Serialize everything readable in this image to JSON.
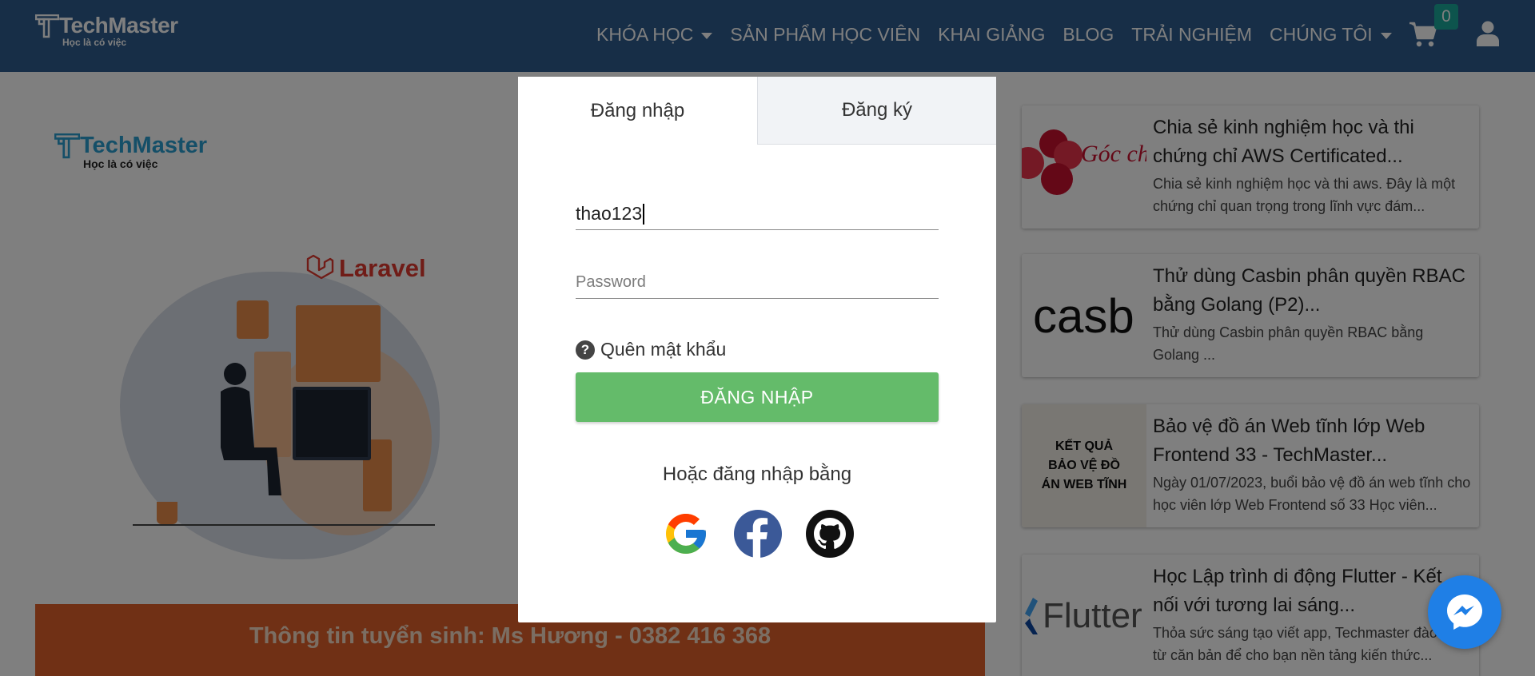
{
  "header": {
    "logo_text": "TechMaster",
    "logo_tagline": "Học là có việc",
    "nav": [
      {
        "label": "KHÓA HỌC",
        "dropdown": true
      },
      {
        "label": "SẢN PHẨM HỌC VIÊN",
        "dropdown": false
      },
      {
        "label": "KHAI GIẢNG",
        "dropdown": false
      },
      {
        "label": "BLOG",
        "dropdown": false
      },
      {
        "label": "TRẢI NGHIỆM",
        "dropdown": false
      },
      {
        "label": "CHÚNG TÔI",
        "dropdown": true
      }
    ],
    "cart_count": "0",
    "cart_icon": "shopping-cart-icon",
    "user_icon": "user-icon"
  },
  "background": {
    "logo_text": "TechMaster",
    "logo_tagline": "Học là có việc",
    "laravel_label": "Laravel",
    "banner_text": "Thông tin tuyển sinh: Ms Hương - 0382 416 368",
    "posts": [
      {
        "thumb_text": "Góc chia sẻ",
        "title": "Chia sẻ kinh nghiệm học và thi chứng chỉ AWS Certificated...",
        "desc": "Chia sẻ kinh nghiệm học và thi aws. Đây là một chứng chỉ quan trọng trong lĩnh vực đám..."
      },
      {
        "thumb_text": "casb",
        "title": "Thử dùng Casbin phân quyền RBAC bằng Golang (P2)...",
        "desc": "Thử dùng Casbin phân quyền RBAC bằng Golang ..."
      },
      {
        "thumb_text": "KẾT QUẢ BẢO VỆ ĐỒ ÁN WEB TĨNH",
        "title": "Bảo vệ đồ án Web tĩnh lớp Web Frontend 33 - TechMaster...",
        "desc": "Ngày 01/07/2023, buổi bảo vệ đồ án web tĩnh cho học viên lớp Web Frontend số 33 Học viên..."
      },
      {
        "thumb_text": "Flutter",
        "title": "Học Lập trình di động Flutter - Kết nối với tương lai sáng...",
        "desc": "Thỏa sức sáng tạo viết app, Techmaster đào tạo từ căn bản để cho bạn nền tảng kiến thức..."
      }
    ]
  },
  "login": {
    "tab_login": "Đăng nhập",
    "tab_register": "Đăng ký",
    "username_value": "thao123",
    "password_placeholder": "Password",
    "forgot_label": "Quên mật khẩu",
    "login_button": "ĐĂNG NHẬP",
    "or_text": "Hoặc đăng nhập bằng",
    "social_icons": [
      "google-icon",
      "facebook-icon",
      "github-icon"
    ]
  },
  "colors": {
    "header_bg": "#2f5d8e",
    "login_button": "#64bb6a",
    "banner": "#e0602a",
    "badge": "#1aa89a",
    "messenger": "#1f7fe6"
  }
}
